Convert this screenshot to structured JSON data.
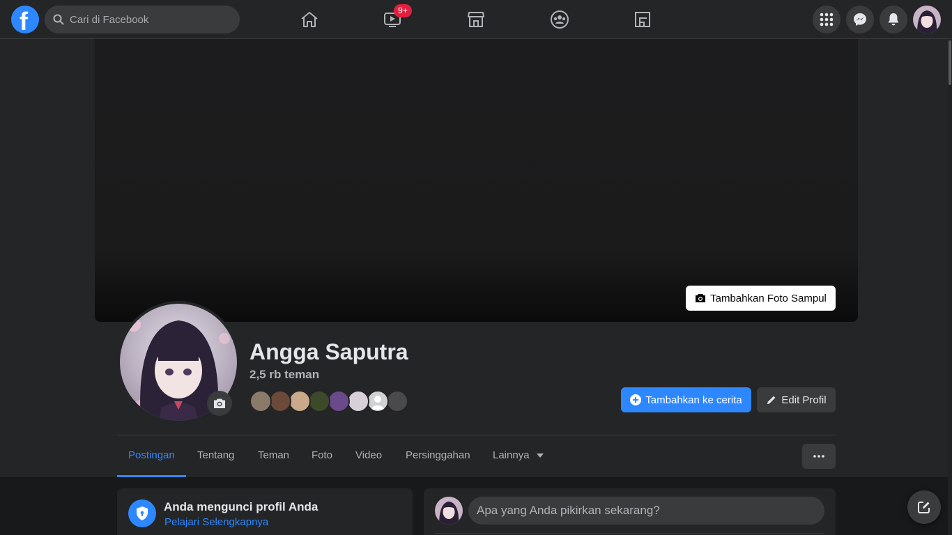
{
  "topbar": {
    "logo_letter": "f",
    "search_placeholder": "Cari di Facebook",
    "nav_icons": [
      "home-icon",
      "watch-icon",
      "marketplace-icon",
      "groups-icon",
      "gaming-icon"
    ],
    "watch_badge": "9+",
    "right_icons": [
      "menu-grid-icon",
      "messenger-icon",
      "notifications-icon"
    ]
  },
  "cover": {
    "add_cover_label": "Tambahkan Foto Sampul"
  },
  "profile": {
    "name": "Angga Saputra",
    "friend_count": "2,5 rb teman"
  },
  "actions": {
    "add_story_label": "Tambahkan ke cerita",
    "edit_profile_label": "Edit Profil"
  },
  "tabs": [
    {
      "label": "Postingan",
      "active": true
    },
    {
      "label": "Tentang"
    },
    {
      "label": "Teman"
    },
    {
      "label": "Foto"
    },
    {
      "label": "Video"
    },
    {
      "label": "Persinggahan"
    },
    {
      "label": "Lainnya"
    }
  ],
  "lock_notice": {
    "title": "Anda mengunci profil Anda",
    "link": "Pelajari Selengkapnya"
  },
  "composer": {
    "placeholder": "Apa yang Anda pikirkan sekarang?"
  },
  "colors": {
    "accent": "#2d88ff",
    "badge": "#e41e3f",
    "background": "#18191a",
    "surface": "#242526"
  }
}
